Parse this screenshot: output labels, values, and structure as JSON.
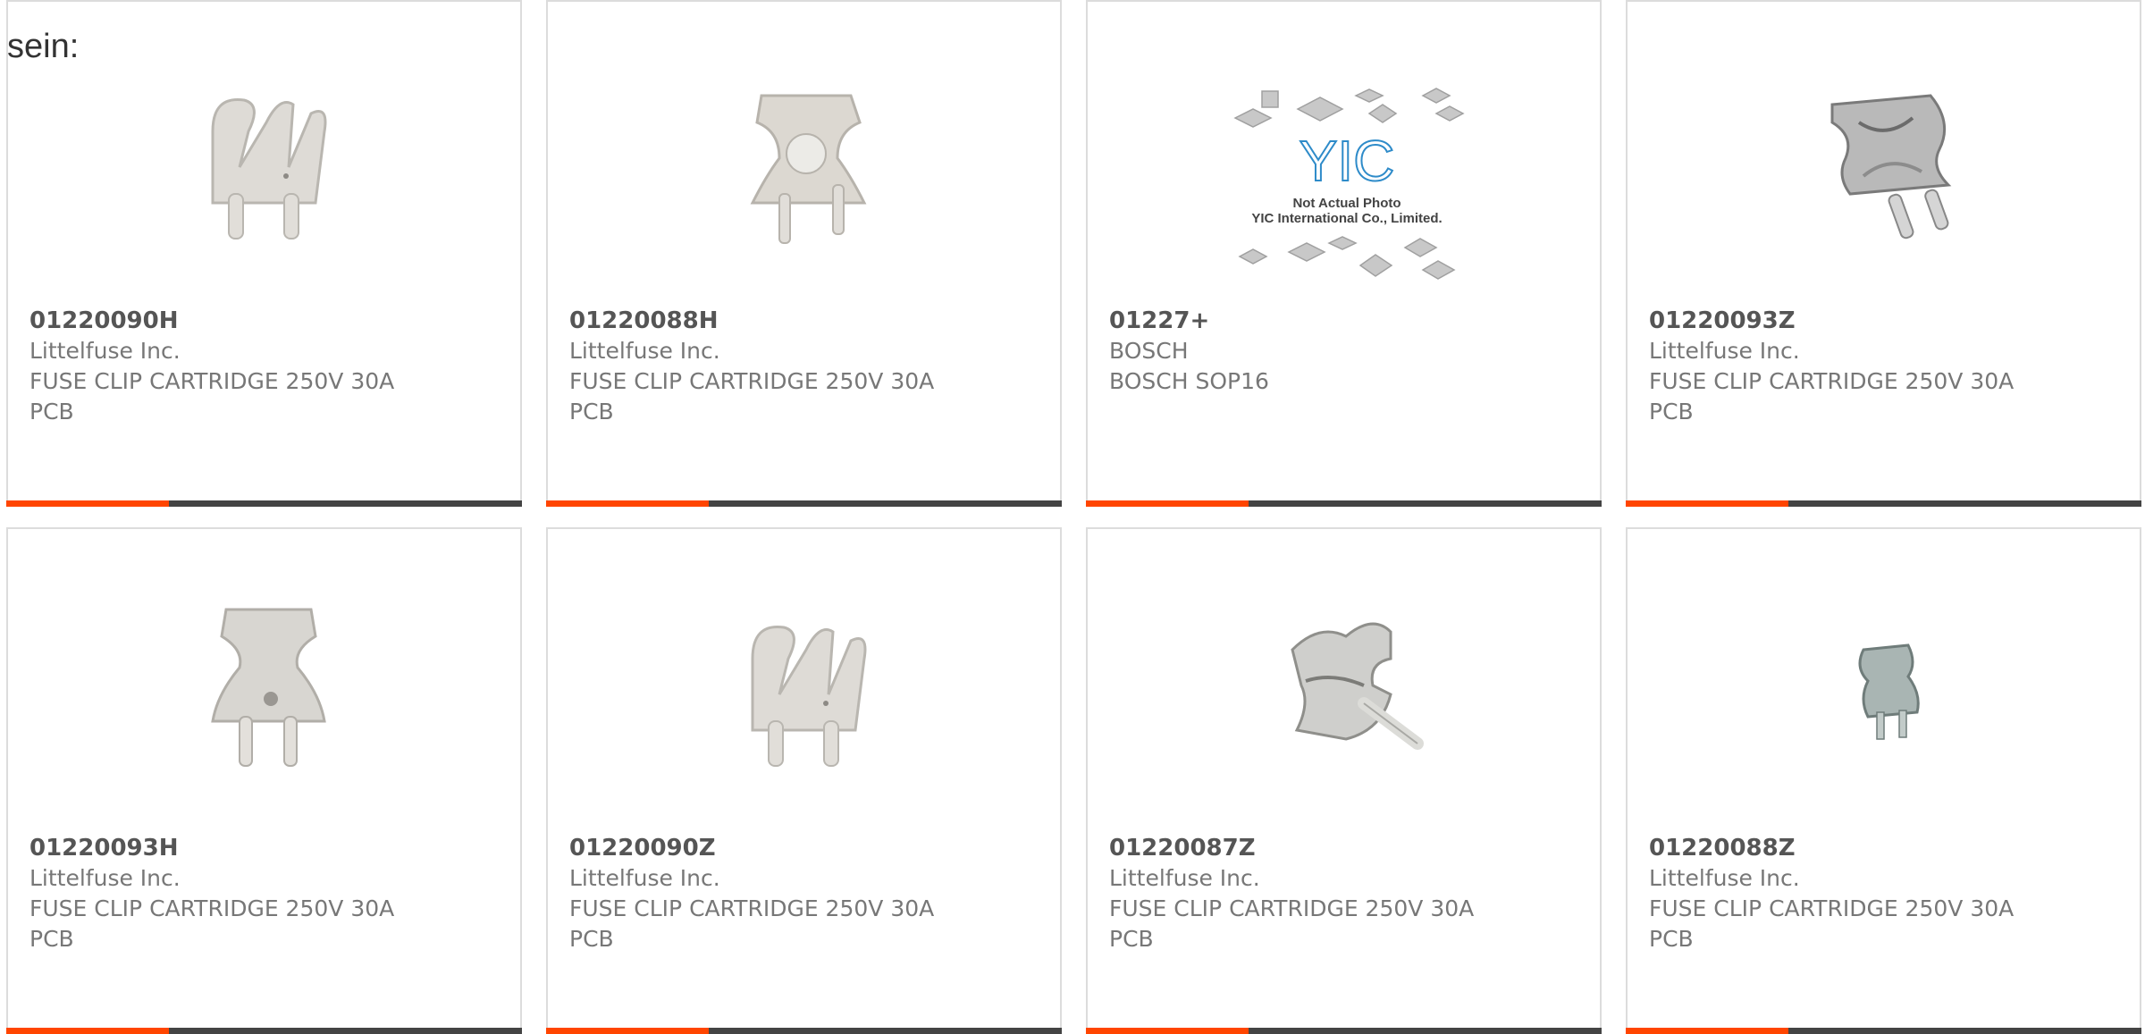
{
  "lead_text": "sein:",
  "colors": {
    "accent": "#ff4500",
    "bar": "#444444",
    "border": "#dcdcdc",
    "text": "#777777",
    "part_number": "#555555"
  },
  "products": [
    {
      "part_number": "01220090H",
      "manufacturer": "Littelfuse Inc.",
      "desc1": "FUSE CLIP CARTRIDGE 250V 30A",
      "desc2": "PCB",
      "image": "fuse-clip-icon"
    },
    {
      "part_number": "01220088H",
      "manufacturer": "Littelfuse Inc.",
      "desc1": "FUSE CLIP CARTRIDGE 250V 30A",
      "desc2": "PCB",
      "image": "fuse-clip-icon"
    },
    {
      "part_number": "01227+",
      "manufacturer": "BOSCH",
      "desc1": "BOSCH SOP16",
      "desc2": "",
      "image": "placeholder-chips-icon",
      "placeholder": {
        "brand": "YIC",
        "line1": "Not Actual Photo",
        "line2": "YIC International Co., Limited."
      }
    },
    {
      "part_number": "01220093Z",
      "manufacturer": "Littelfuse Inc.",
      "desc1": "FUSE CLIP CARTRIDGE 250V 30A",
      "desc2": "PCB",
      "image": "fuse-clip-icon"
    },
    {
      "part_number": "01220093H",
      "manufacturer": "Littelfuse Inc.",
      "desc1": "FUSE CLIP CARTRIDGE 250V 30A",
      "desc2": "PCB",
      "image": "fuse-clip-icon"
    },
    {
      "part_number": "01220090Z",
      "manufacturer": "Littelfuse Inc.",
      "desc1": "FUSE CLIP CARTRIDGE 250V 30A",
      "desc2": "PCB",
      "image": "fuse-clip-icon"
    },
    {
      "part_number": "01220087Z",
      "manufacturer": "Littelfuse Inc.",
      "desc1": "FUSE CLIP CARTRIDGE 250V 30A",
      "desc2": "PCB",
      "image": "fuse-clip-icon"
    },
    {
      "part_number": "01220088Z",
      "manufacturer": "Littelfuse Inc.",
      "desc1": "FUSE CLIP CARTRIDGE 250V 30A",
      "desc2": "PCB",
      "image": "fuse-clip-icon"
    }
  ]
}
